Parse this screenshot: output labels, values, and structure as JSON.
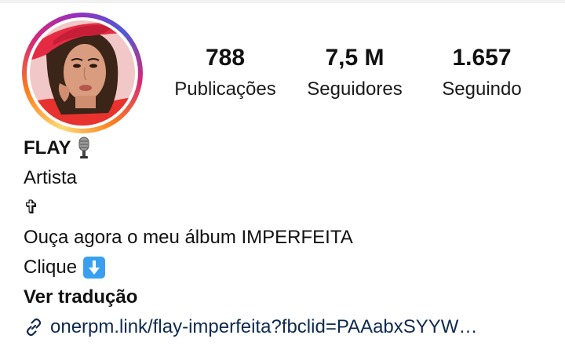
{
  "profile": {
    "name": "FLAY",
    "name_emoji_icon": "microphone-icon",
    "category": "Artista",
    "cross_symbol": "✞",
    "bio_line1": "Ouça agora o meu álbum IMPERFEITA",
    "bio_line2": "Clique",
    "bio_line2_emoji_icon": "down-arrow-icon",
    "translate_label": "Ver tradução",
    "link_text": "onerpm.link/flay-imperfeita?fbclid=PAAabxSYYW…",
    "story_ring_colors": [
      "#feda75",
      "#fa7e1e",
      "#d62976",
      "#962fbf",
      "#4f5bd5"
    ],
    "arrow_emoji_color": "#39a0f0"
  },
  "stats": [
    {
      "value": "788",
      "label": "Publicações"
    },
    {
      "value": "7,5 M",
      "label": "Seguidores"
    },
    {
      "value": "1.657",
      "label": "Seguindo"
    }
  ]
}
